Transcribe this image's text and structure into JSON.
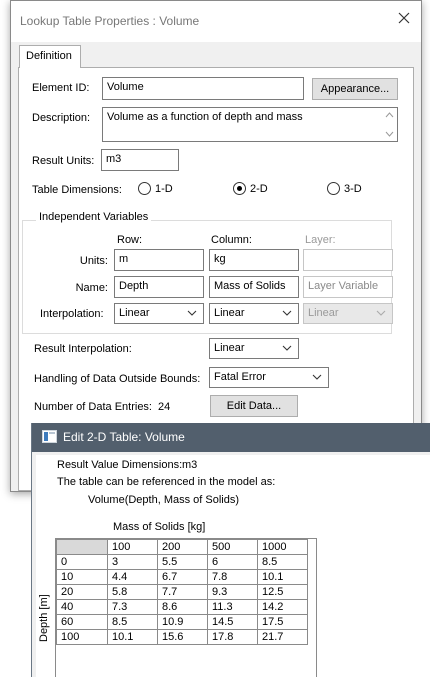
{
  "main_dialog": {
    "title": "Lookup Table Properties : Volume",
    "tab_label": "Definition",
    "element_id_label": "Element ID:",
    "element_id_value": "Volume",
    "appearance_button": "Appearance...",
    "description_label": "Description:",
    "description_value": "Volume as a function of depth and mass",
    "result_units_label": "Result Units:",
    "result_units_value": "m3",
    "table_dimensions_label": "Table Dimensions:",
    "dimension_options": [
      {
        "label": "1-D",
        "selected": false
      },
      {
        "label": "2-D",
        "selected": true
      },
      {
        "label": "3-D",
        "selected": false
      }
    ],
    "independent_variables": {
      "group_label": "Independent Variables",
      "row_header": "Row:",
      "column_header": "Column:",
      "layer_header": "Layer:",
      "units_label": "Units:",
      "name_label": "Name:",
      "interpolation_label": "Interpolation:",
      "row": {
        "units": "m",
        "name": "Depth",
        "interpolation": "Linear"
      },
      "column": {
        "units": "kg",
        "name": "Mass of Solids",
        "interpolation": "Linear"
      },
      "layer": {
        "units": "",
        "name": "Layer Variable",
        "interpolation": "Linear",
        "disabled": true
      }
    },
    "result_interpolation_label": "Result Interpolation:",
    "result_interpolation_value": "Linear",
    "out_of_bounds_label": "Handling of Data Outside Bounds:",
    "out_of_bounds_value": "Fatal Error",
    "data_entries_label": "Number of Data Entries:",
    "data_entries_count": "24",
    "edit_data_button": "Edit Data..."
  },
  "table_window": {
    "title": "Edit 2-D Table: Volume",
    "result_dims_label": "Result Value Dimensions:",
    "result_dims_value": "m3",
    "reference_text": "The table can be referenced in the model as:",
    "reference_expr": "Volume(Depth, Mass of Solids)",
    "column_axis_label": "Mass of Solids [kg]",
    "row_axis_label": "Depth [m]",
    "column_headers": [
      "100",
      "200",
      "500",
      "1000"
    ],
    "rows": [
      {
        "key": "0",
        "values": [
          "3",
          "5.5",
          "6",
          "8.5"
        ]
      },
      {
        "key": "10",
        "values": [
          "4.4",
          "6.7",
          "7.8",
          "10.1"
        ]
      },
      {
        "key": "20",
        "values": [
          "5.8",
          "7.7",
          "9.3",
          "12.5"
        ]
      },
      {
        "key": "40",
        "values": [
          "7.3",
          "8.6",
          "11.3",
          "14.2"
        ]
      },
      {
        "key": "60",
        "values": [
          "8.5",
          "10.9",
          "14.5",
          "17.5"
        ]
      },
      {
        "key": "100",
        "values": [
          "10.1",
          "15.6",
          "17.8",
          "21.7"
        ]
      }
    ]
  },
  "colors": {
    "dialog_bg": "#f0f0f0",
    "titlebar_dark": "#525f6d",
    "button_bg": "#e1e1e1"
  }
}
